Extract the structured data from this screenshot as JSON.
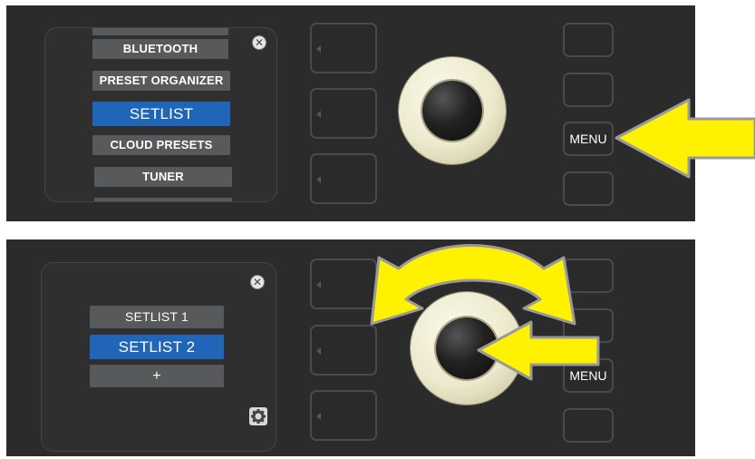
{
  "top_screen": {
    "items": [
      {
        "label": "BLUETOOTH",
        "selected": false
      },
      {
        "label": "PRESET ORGANIZER",
        "selected": false
      },
      {
        "label": "SETLIST",
        "selected": true
      },
      {
        "label": "CLOUD PRESETS",
        "selected": false
      },
      {
        "label": "TUNER",
        "selected": false
      }
    ],
    "close_icon": "close-icon"
  },
  "top_right_buttons": {
    "menu_label": "MENU"
  },
  "bottom_screen": {
    "items": [
      {
        "label": "SETLIST 1",
        "selected": false
      },
      {
        "label": "SETLIST 2",
        "selected": true
      },
      {
        "label": "+",
        "selected": false
      }
    ],
    "close_icon": "close-icon",
    "settings_icon": "gear-icon"
  },
  "bottom_right_buttons": {
    "menu_label": "MENU"
  },
  "colors": {
    "panel": "#2b2b2c",
    "selected": "#1f66b8",
    "item": "#58595b",
    "arrow": "#fff200",
    "knob": "#ece9cc"
  }
}
